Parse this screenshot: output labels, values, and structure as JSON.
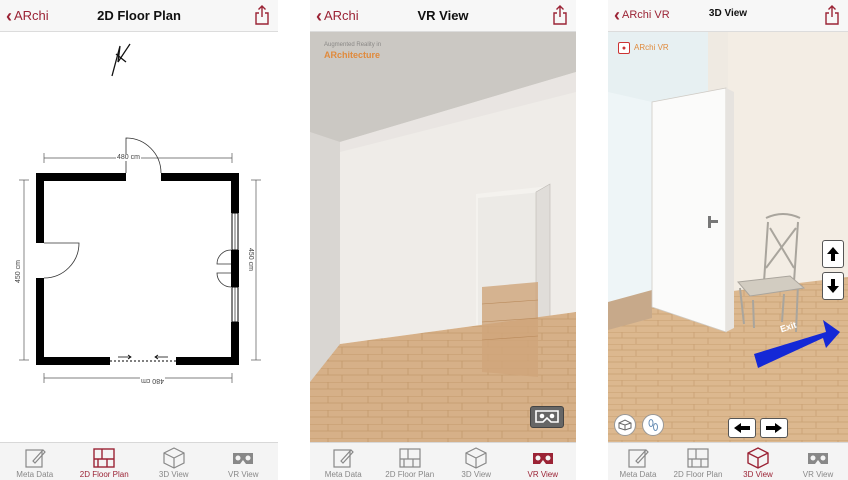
{
  "phones": [
    {
      "back_label": "ARchi",
      "title": "2D Floor Plan",
      "active_tab": "2D Floor Plan",
      "dimensions": {
        "top": "480 cm",
        "bottom": "480 cm",
        "left": "450 cm",
        "right": "450 cm"
      }
    },
    {
      "back_label": "ARchi",
      "title": "VR View",
      "active_tab": "VR View",
      "watermark_line1": "Augmented Reality in",
      "watermark_line2": "ARchitecture"
    },
    {
      "back_label": "ARchi VR",
      "title": "3D View",
      "active_tab": "3D View",
      "logo_text": "ARchi VR",
      "exit_label": "Exit"
    }
  ],
  "tabs": [
    "Meta Data",
    "2D Floor Plan",
    "3D View",
    "VR View"
  ],
  "colors": {
    "accent": "#9b2335",
    "floor": "#d8b283",
    "wall": "#f1eeea",
    "arrow": "#1428d6"
  },
  "icons": {
    "back": "chevron-left-icon",
    "share": "share-icon",
    "cardboard": "vr-cardboard-icon"
  }
}
